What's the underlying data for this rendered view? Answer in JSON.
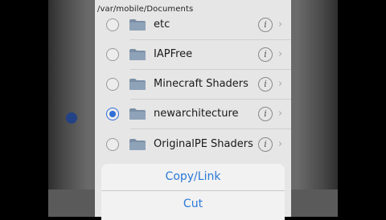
{
  "path": "/var/mobile/Documents",
  "files": [
    {
      "name": "etc",
      "selected": false
    },
    {
      "name": "IAPFree",
      "selected": false
    },
    {
      "name": "Minecraft Shaders",
      "selected": false
    },
    {
      "name": "newarchitecture",
      "selected": true
    },
    {
      "name": "OriginalPE Shaders",
      "selected": false
    }
  ],
  "info_glyph": "i",
  "chevron_glyph": "›",
  "action_sheet": {
    "copy_link_label": "Copy/Link",
    "cut_label": "Cut"
  },
  "colors": {
    "accent": "#2a78d8",
    "folder": "#7b8fa6"
  }
}
